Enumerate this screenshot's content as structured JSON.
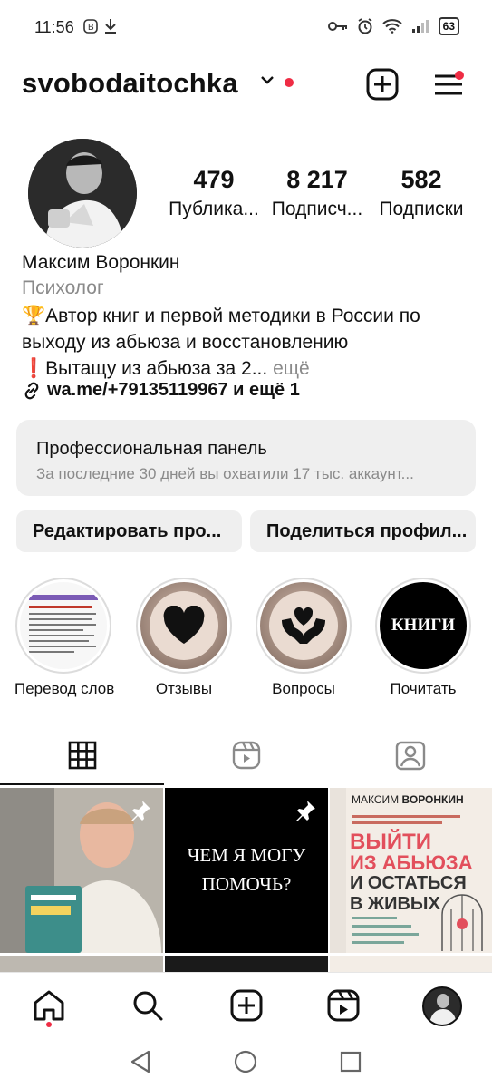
{
  "status_bar": {
    "time": "11:56",
    "battery": "63"
  },
  "header": {
    "username": "svobodaitochka"
  },
  "stats": [
    {
      "num": "479",
      "label": "Публика..."
    },
    {
      "num": "8 217",
      "label": "Подписч..."
    },
    {
      "num": "582",
      "label": "Подписки"
    }
  ],
  "profile": {
    "name": "Максим Воронкин",
    "category": "Психолог",
    "bio_line1": "🏆Автор книг и первой методики в России по",
    "bio_line2": "выходу из абьюза и восстановлению",
    "bio_line3": "❗Вытащу из абьюза за 2...",
    "bio_more": "ещё",
    "link": "wa.me/+79135119967 и ещё 1"
  },
  "pro_panel": {
    "title": "Профессиональная панель",
    "subtitle": "За последние 30 дней вы охватили 17 тыс. аккаунт..."
  },
  "actions": {
    "edit": "Редактировать про...",
    "share": "Поделиться профил..."
  },
  "highlights": [
    {
      "label": "Перевод слов",
      "icon": "document-thumbnail"
    },
    {
      "label": "Отзывы",
      "icon": "heart-icon"
    },
    {
      "label": "Вопросы",
      "icon": "hands-heart-icon"
    },
    {
      "label": "Почитать",
      "text": "КНИГИ"
    }
  ],
  "tabs": [
    "grid-icon",
    "reels-icon",
    "tagged-icon"
  ],
  "posts": {
    "post2_text_line1": "ЧЕМ Я МОГУ",
    "post2_text_line2": "ПОМОЧЬ?",
    "post3_author_first": "МАКСИМ",
    "post3_author_last": "ВОРОНКИН",
    "post3_title_line1": "ВЫЙТИ",
    "post3_title_line2": "ИЗ АБЬЮЗА",
    "post3_title_line3": "И ОСТАТЬСЯ",
    "post3_title_line4": "В ЖИВЫХ"
  },
  "colors": {
    "accent_red": "#ef2c44",
    "panel_bg": "#efefef",
    "muted_text": "#8a8a8a"
  }
}
